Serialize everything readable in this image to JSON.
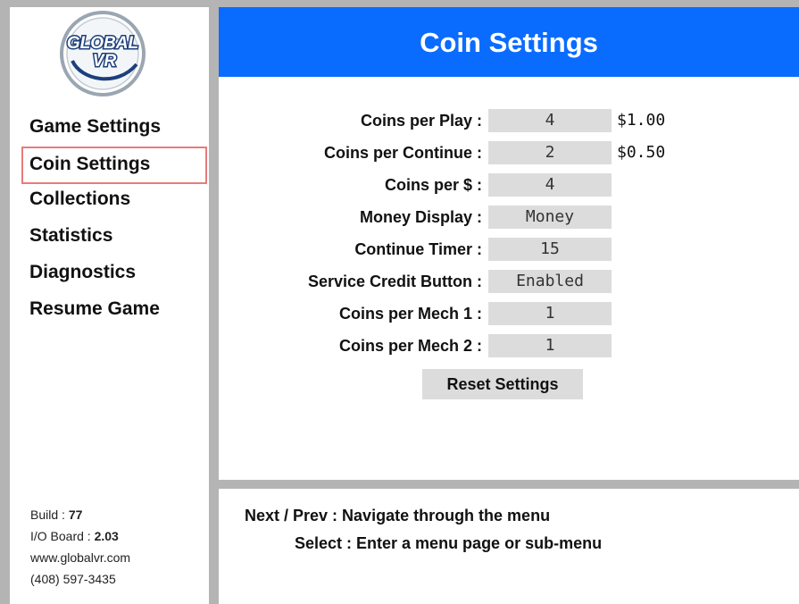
{
  "logo": {
    "text_top": "GLOBAL",
    "text_bottom": "VR",
    "icon": "globalvr-logo-icon"
  },
  "menu": {
    "items": [
      {
        "label": "Game Settings"
      },
      {
        "label": "Coin Settings",
        "selected": true
      },
      {
        "label": "Collections"
      },
      {
        "label": "Statistics"
      },
      {
        "label": "Diagnostics"
      },
      {
        "label": "Resume Game"
      }
    ]
  },
  "info": {
    "build_label": "Build : ",
    "build_value": "77",
    "io_label": "I/O Board : ",
    "io_value": "2.03",
    "website": "www.globalvr.com",
    "phone": "(408) 597-3435"
  },
  "page": {
    "title": "Coin Settings"
  },
  "settings": [
    {
      "label": "Coins per Play :",
      "value": "4",
      "extra": "$1.00"
    },
    {
      "label": "Coins per Continue :",
      "value": "2",
      "extra": "$0.50"
    },
    {
      "label": "Coins per $ :",
      "value": "4",
      "extra": ""
    },
    {
      "label": "Money Display :",
      "value": "Money",
      "extra": ""
    },
    {
      "label": "Continue Timer :",
      "value": "15",
      "extra": ""
    },
    {
      "label": "Service Credit Button :",
      "value": "Enabled",
      "extra": ""
    },
    {
      "label": "Coins per Mech 1 :",
      "value": "1",
      "extra": ""
    },
    {
      "label": "Coins per Mech 2 :",
      "value": "1",
      "extra": ""
    }
  ],
  "reset_label": "Reset Settings",
  "help": {
    "line1": "Next / Prev : Navigate through the menu",
    "line2": "Select : Enter a menu page or sub-menu"
  },
  "colors": {
    "title_bar": "#0a6cff",
    "frame": "#b4b4b4",
    "selection_border": "#e87b7b",
    "value_box": "#dcdcdc"
  }
}
